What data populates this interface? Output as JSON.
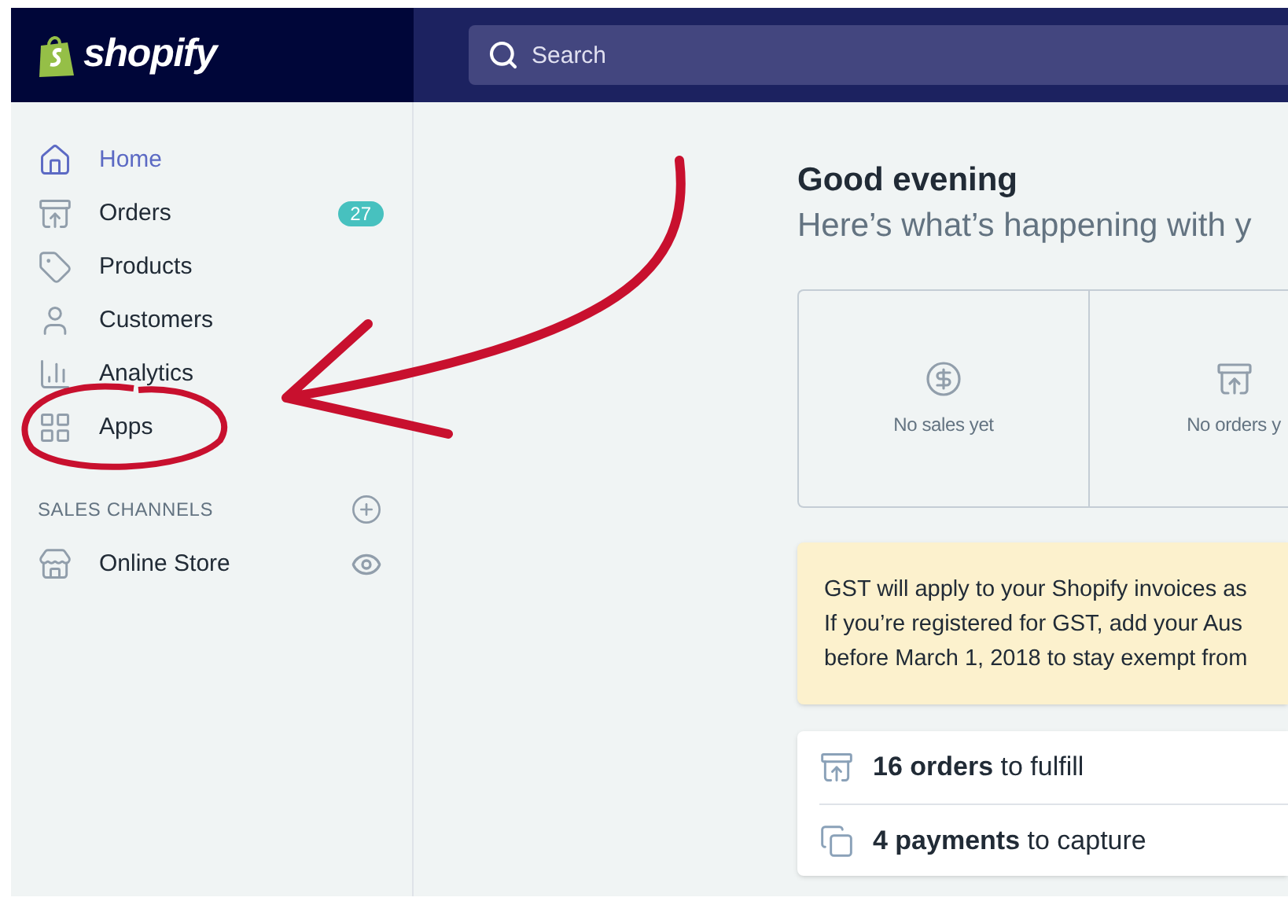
{
  "brand": {
    "name": "shopify"
  },
  "search": {
    "placeholder": "Search"
  },
  "sidebar": {
    "items": [
      {
        "label": "Home",
        "selected": true
      },
      {
        "label": "Orders",
        "selected": false,
        "badge": "27"
      },
      {
        "label": "Products",
        "selected": false
      },
      {
        "label": "Customers",
        "selected": false
      },
      {
        "label": "Analytics",
        "selected": false
      },
      {
        "label": "Apps",
        "selected": false
      }
    ],
    "section": {
      "title": "SALES CHANNELS",
      "items": [
        {
          "label": "Online Store",
          "selected": false
        }
      ]
    }
  },
  "main": {
    "greeting": "Good evening",
    "subtitle": "Here’s what’s happening with y",
    "stats": [
      {
        "label": "No sales yet"
      },
      {
        "label": "No orders y"
      }
    ],
    "banner": {
      "lines": [
        "GST will apply to your Shopify invoices as",
        "If you’re registered for GST, add your Aus",
        "before March 1, 2018 to stay exempt from"
      ]
    },
    "tasks": [
      {
        "text": "**16 orders** to fulfill"
      },
      {
        "text": "**4 payments** to capture"
      }
    ]
  }
}
